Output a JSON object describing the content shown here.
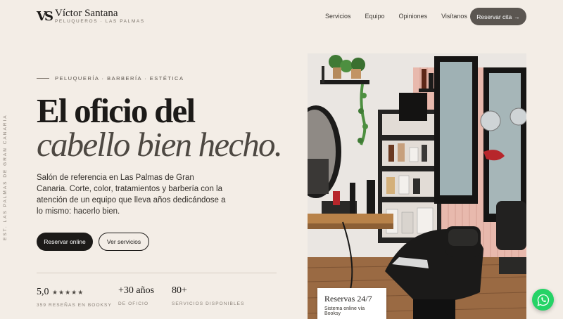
{
  "brand": {
    "mark": "VS",
    "name": "Víctor Santana",
    "tagline": "PELUQUEROS · LAS PALMAS"
  },
  "nav": {
    "items": [
      "Servicios",
      "Equipo",
      "Opiniones",
      "Visítanos"
    ],
    "cta": "Reservar cita",
    "cta_arrow": "→"
  },
  "side_text": "EST. LAS PALMAS DE GRAN CANARIA",
  "hero": {
    "eyebrow": "PELUQUERÍA · BARBERÍA · ESTÉTICA",
    "title_line1": "El oficio del",
    "title_line2": "cabello bien hecho.",
    "lead": "Salón de referencia en Las Palmas de Gran Canaria. Corte, color, tratamientos y barbería con la atención de un equipo que lleva años dedicándose a lo mismo: hacerlo bien.",
    "primary_button": "Reservar online",
    "secondary_button": "Ver servicios"
  },
  "stats": [
    {
      "value": "5,0",
      "stars": "★★★★★",
      "label": "359 RESEÑAS EN BOOKSY"
    },
    {
      "value": "+30 años",
      "label": "DE OFICIO"
    },
    {
      "value": "80+",
      "label": "SERVICIOS DISPONIBLES"
    }
  ],
  "rating": {
    "stars_filled": 5,
    "stars_total": 5
  },
  "badge": {
    "title": "Reservas 24/7",
    "subtitle": "Sistema online vía Booksy"
  },
  "colors": {
    "background": "#f3ede6",
    "ink": "#1c1a18",
    "muted": "#8a8178",
    "cta_top": "#5b5651",
    "whatsapp": "#25d366"
  },
  "icons": {
    "whatsapp": "whatsapp-icon",
    "arrow": "arrow-right-icon"
  }
}
